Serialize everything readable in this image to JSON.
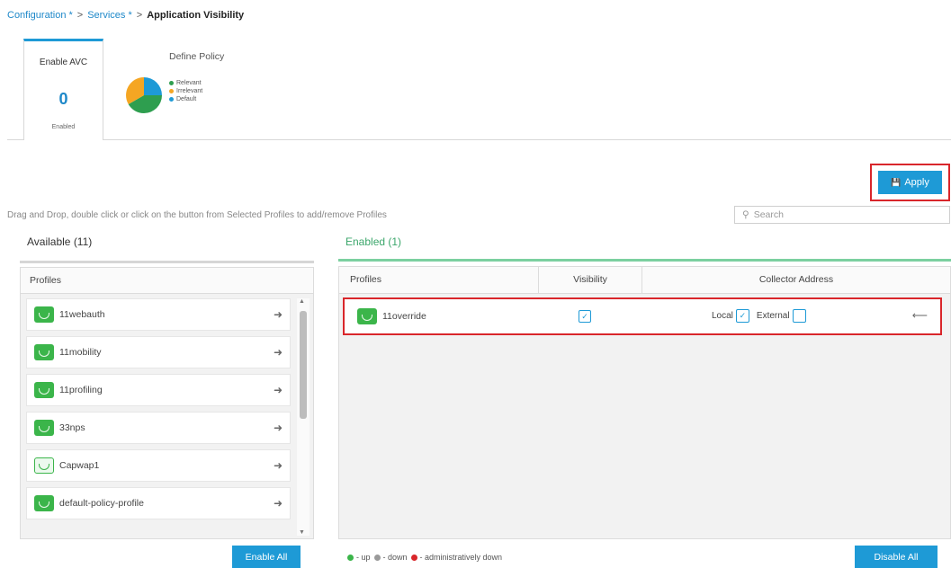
{
  "breadcrumb": {
    "configuration": "Configuration *",
    "services": "Services *",
    "separator": ">",
    "current": "Application Visibility"
  },
  "tabs": {
    "enable_avc": {
      "title": "Enable AVC",
      "count": "0",
      "sub": "Enabled"
    },
    "define_policy": {
      "title": "Define Policy",
      "legend": [
        {
          "label": "Relevant",
          "color": "#2e9e4f"
        },
        {
          "label": "Irrelevant",
          "color": "#f5a623"
        },
        {
          "label": "Default",
          "color": "#1e9ad6"
        }
      ]
    }
  },
  "toolbar": {
    "apply_label": "Apply",
    "apply_icon": "save-icon"
  },
  "hint": "Drag and Drop, double click or click on the button from Selected Profiles to add/remove Profiles",
  "search": {
    "placeholder": "Search",
    "value": ""
  },
  "available": {
    "title": "Available (11)",
    "column": "Profiles",
    "items": [
      {
        "label": "11webauth"
      },
      {
        "label": "11mobility"
      },
      {
        "label": "11profiling"
      },
      {
        "label": "33nps"
      },
      {
        "label": "Capwap1"
      },
      {
        "label": "default-policy-profile"
      }
    ],
    "enable_all_label": "Enable All"
  },
  "enabled": {
    "title": "Enabled (1)",
    "columns": {
      "profiles": "Profiles",
      "visibility": "Visibility",
      "collector": "Collector Address"
    },
    "rows": [
      {
        "profile": "11override",
        "visibility": true,
        "local_label": "Local",
        "local": true,
        "external_label": "External",
        "external": false
      }
    ],
    "disable_all_label": "Disable All"
  },
  "status_legend": [
    {
      "label": "- up",
      "color": "#3bb54a"
    },
    {
      "label": "- down",
      "color": "#9a9a9a"
    },
    {
      "label": "- administratively down",
      "color": "#d9262b"
    }
  ],
  "colors": {
    "accent": "#1e9ad6",
    "enabled_green": "#3ba66b",
    "highlight_red": "#d9262b"
  }
}
